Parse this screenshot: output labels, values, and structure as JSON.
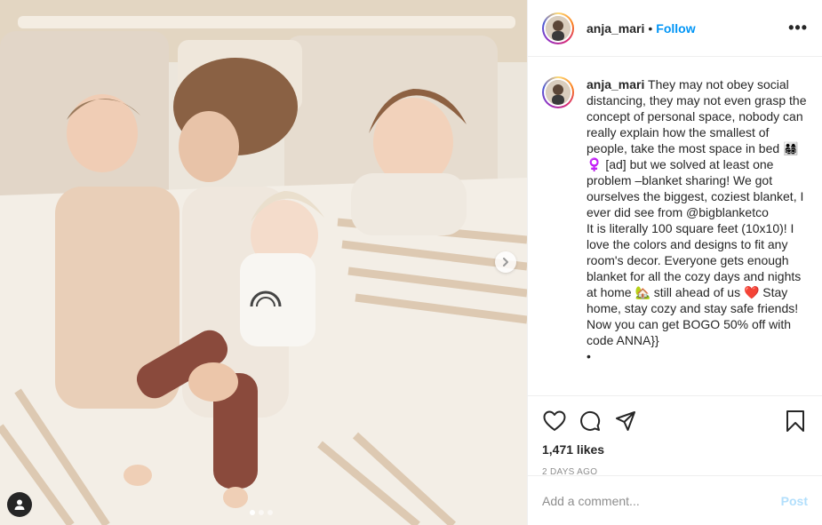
{
  "post": {
    "username": "anja_mari",
    "separator": "•",
    "follow_label": "Follow",
    "more_label": "•••",
    "caption_text": "They may not obey social distancing, they may not even grasp the concept of personal space, nobody can really explain how the smallest of people, take the most space in bed 👨‍👩‍👧‍👦♀️ [ad] but we solved at least one problem –blanket sharing! We got ourselves the biggest, coziest blanket, I ever did see from @bigblanketco\nIt is literally 100 square feet (10x10)! I love the colors and designs to fit any room's decor. Everyone gets enough blanket for all the cozy days and nights at home 🏡 still ahead of us ❤️ Stay home, stay cozy and stay safe friends! Now you can get BOGO 50% off with code ANNA}}\n•",
    "likes": "1,471 likes",
    "time_ago": "2 DAYS AGO",
    "carousel_count": 3,
    "carousel_active": 0
  },
  "comment": {
    "placeholder": "Add a comment...",
    "post_label": "Post"
  },
  "colors": {
    "link_blue": "#0095f6",
    "post_disabled": "#b2dffc",
    "muted": "#8e8e8e"
  },
  "icons": [
    "heart-icon",
    "comment-icon",
    "share-icon",
    "bookmark-icon",
    "chevron-right-icon",
    "user-tag-icon",
    "more-icon"
  ]
}
